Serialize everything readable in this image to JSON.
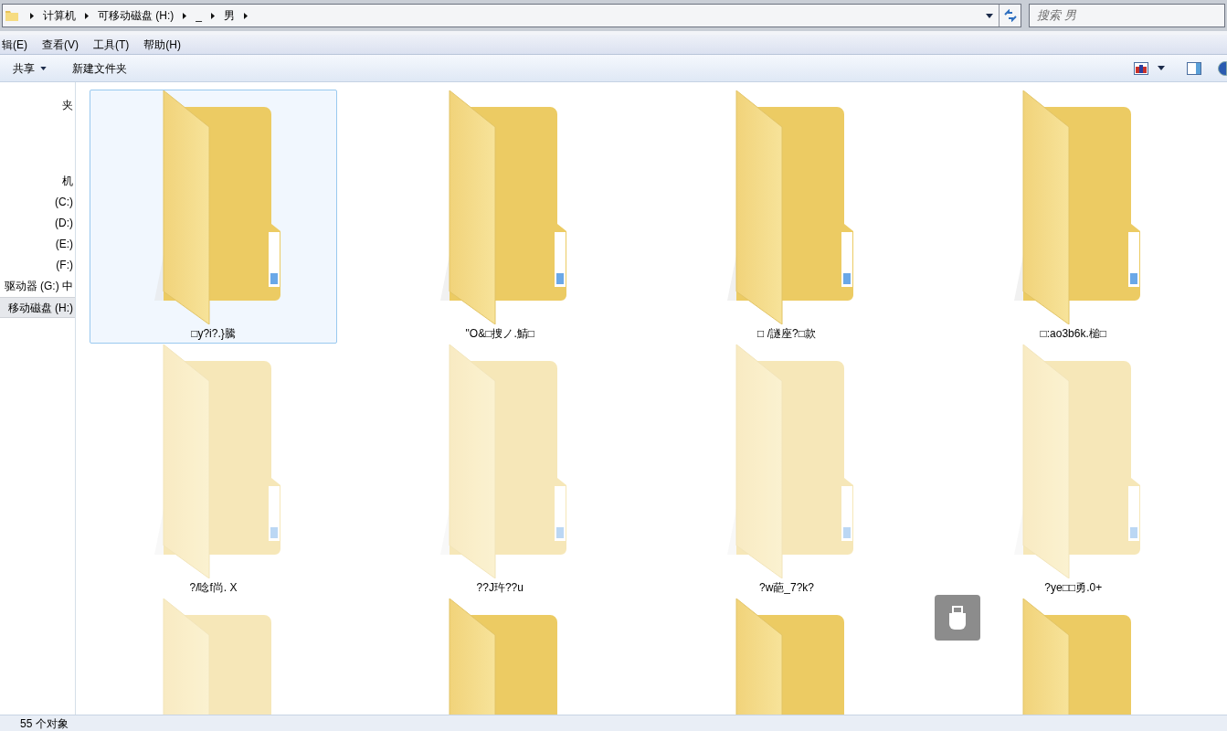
{
  "address_bar": {
    "crumbs": [
      "计算机",
      "可移动磁盘 (H:)",
      "_",
      "男"
    ]
  },
  "search": {
    "placeholder": "搜索 男"
  },
  "menu_bar": [
    "辑(E)",
    "查看(V)",
    "工具(T)",
    "帮助(H)"
  ],
  "toolbar": {
    "buttons": [
      {
        "label": "共享",
        "dropdown": true
      },
      {
        "label": "新建文件夹",
        "dropdown": false
      }
    ]
  },
  "sidebar": {
    "groups": [
      {
        "items": [
          {
            "label": "夹",
            "selected": false
          }
        ]
      },
      {
        "items": [
          {
            "label": "机",
            "selected": false
          },
          {
            "label": "(C:)",
            "selected": false
          },
          {
            "label": "(D:)",
            "selected": false
          },
          {
            "label": "(E:)",
            "selected": false
          },
          {
            "label": "(F:)",
            "selected": false
          },
          {
            "label": "驱动器 (G:) 中",
            "selected": false
          },
          {
            "label": "移动磁盘 (H:)",
            "selected": true
          }
        ]
      }
    ]
  },
  "folders": [
    {
      "name": "□y?i?.}騰",
      "selected": true,
      "hidden": false
    },
    {
      "name": "\"O&□捜ノ.鯖□",
      "selected": false,
      "hidden": false
    },
    {
      "name": "□ /譢座?□款",
      "selected": false,
      "hidden": false
    },
    {
      "name": "□:ao3b6k.槌□",
      "selected": false,
      "hidden": false
    },
    {
      "name": "?/唸f尚. X",
      "selected": false,
      "hidden": true
    },
    {
      "name": "??J玝??u",
      "selected": false,
      "hidden": true
    },
    {
      "name": "?w葩_7?k?",
      "selected": false,
      "hidden": true
    },
    {
      "name": "?ye□□勇.0+",
      "selected": false,
      "hidden": true
    },
    {
      "selected": false,
      "hidden": true
    },
    {
      "selected": false,
      "hidden": false
    },
    {
      "selected": false,
      "hidden": false
    },
    {
      "selected": false,
      "hidden": false
    }
  ],
  "status_bar": {
    "text": "55 个对象"
  }
}
